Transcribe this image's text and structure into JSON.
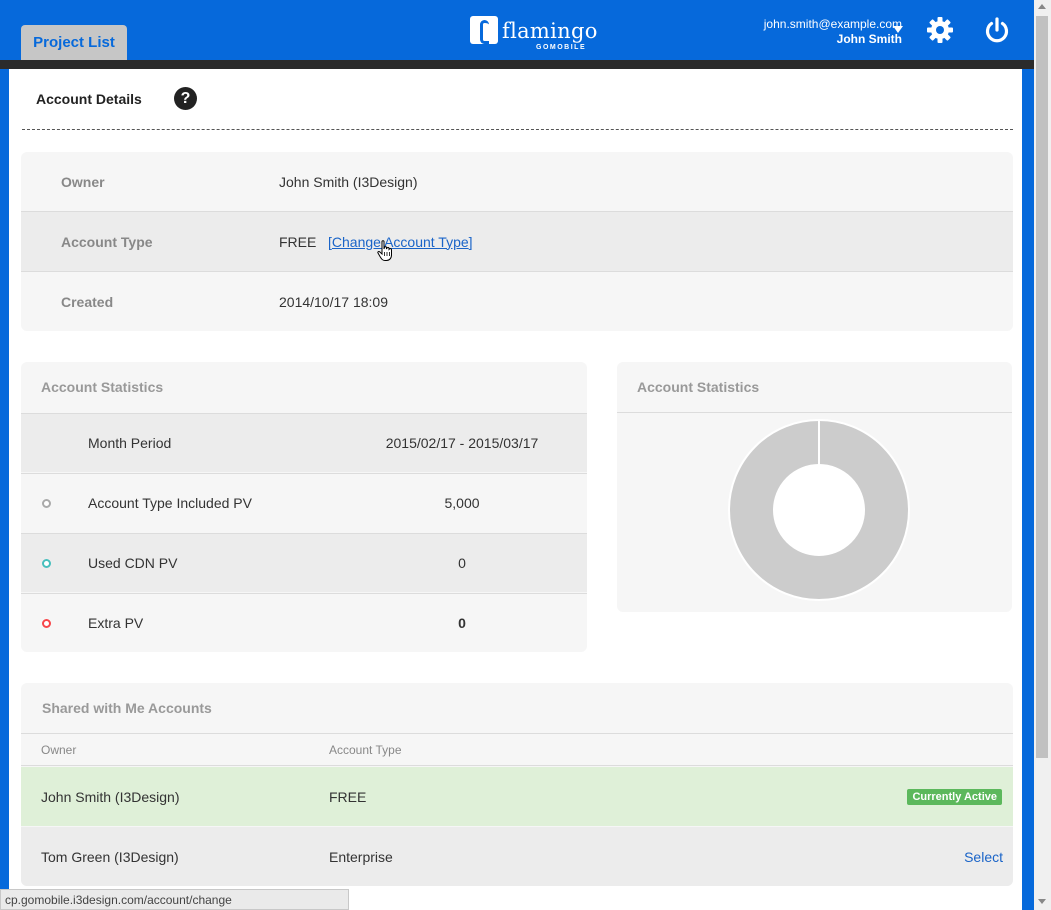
{
  "header": {
    "tab_label": "Project List",
    "logo_text": "flamingo",
    "logo_sub": "GOMOBILE",
    "user_email": "john.smith@example.com",
    "user_name": "John Smith",
    "icons": [
      "dropdown-caret-icon",
      "gear-icon",
      "power-icon"
    ]
  },
  "page": {
    "title": "Account Details",
    "help_glyph": "?"
  },
  "details": {
    "rows": [
      {
        "label": "Owner",
        "value": "John Smith (I3Design)"
      },
      {
        "label": "Account Type",
        "value": "FREE",
        "link_open": "[",
        "link": "Change Account Type",
        "link_close": "]"
      },
      {
        "label": "Created",
        "value": "2014/10/17 18:09"
      }
    ]
  },
  "stats": {
    "title": "Account Statistics",
    "rows": [
      {
        "name": "Month Period",
        "value": "2015/02/17 - 2015/03/17"
      },
      {
        "name": "Account Type Included PV",
        "value": "5,000",
        "dot_color": "#aaaaaa"
      },
      {
        "name": "Used CDN PV",
        "value": "0",
        "dot_color": "#46bfbd"
      },
      {
        "name": "Extra PV",
        "value": "0",
        "dot_color": "#f7464a"
      }
    ]
  },
  "chart": {
    "title": "Account Statistics",
    "chart_data": {
      "type": "pie",
      "style": "doughnut",
      "slices": [
        {
          "label": "Account Type Included PV",
          "value": 5000,
          "color": "#cccccc"
        },
        {
          "label": "Used CDN PV",
          "value": 0,
          "color": "#46bfbd"
        },
        {
          "label": "Extra PV",
          "value": 0,
          "color": "#f7464a"
        }
      ]
    }
  },
  "shared": {
    "title": "Shared with Me Accounts",
    "col_owner": "Owner",
    "col_type": "Account Type",
    "rows": [
      {
        "owner": "John Smith (I3Design)",
        "type": "FREE",
        "status": "Currently Active",
        "bg": "#dff0d8"
      },
      {
        "owner": "Tom Green (I3Design)",
        "type": "Enterprise",
        "action": "Select",
        "bg": "#ececec"
      }
    ]
  },
  "statusbar": {
    "url": "cp.gomobile.i3design.com/account/change"
  },
  "colors": {
    "brand_blue": "#0669db",
    "link": "#1a64c8",
    "active_badge": "#5cb85c"
  }
}
